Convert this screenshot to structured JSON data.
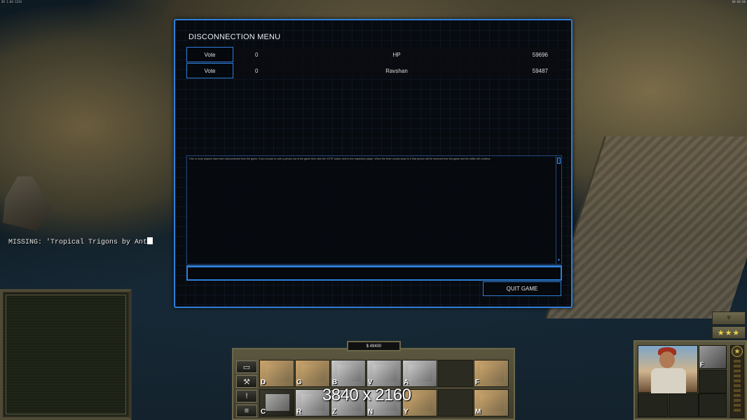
{
  "top_bar": {
    "left_text": "ZH 1.04 1234",
    "right_text": "00:00:00"
  },
  "missing_text": "MISSING: 'Tropical Trigons by Ant",
  "dialog": {
    "title": "DISCONNECTION MENU",
    "players": [
      {
        "vote_label": "Vote",
        "votes": "0",
        "name": "HP",
        "ping": "59696"
      },
      {
        "vote_label": "Vote",
        "votes": "0",
        "name": "Ravshan",
        "ping": "59487"
      }
    ],
    "message": "One or more players have been disconnected from the game. If you choose to vote a person out of the game then click the VOTE button next to the respective player. When the timer counts down to 0 that person will be removed from the game and the battle will continue.",
    "chat_value": "",
    "quit_label": "QUIT GAME"
  },
  "hud": {
    "money": "$ 49400",
    "side_buttons": [
      "▭",
      "⚒",
      "!",
      "≡"
    ],
    "build_keys_row1": [
      "D",
      "G",
      "B",
      "V",
      "A",
      "",
      "F"
    ],
    "build_keys_row2": [
      "C",
      "R",
      "Z",
      "N",
      "Y",
      "",
      "M"
    ],
    "resolution_overlay": "3840 x 2160",
    "arrow_label": "▼",
    "stars_label": "★★★",
    "unit_slot_key": "F",
    "rank_icon": "★"
  }
}
